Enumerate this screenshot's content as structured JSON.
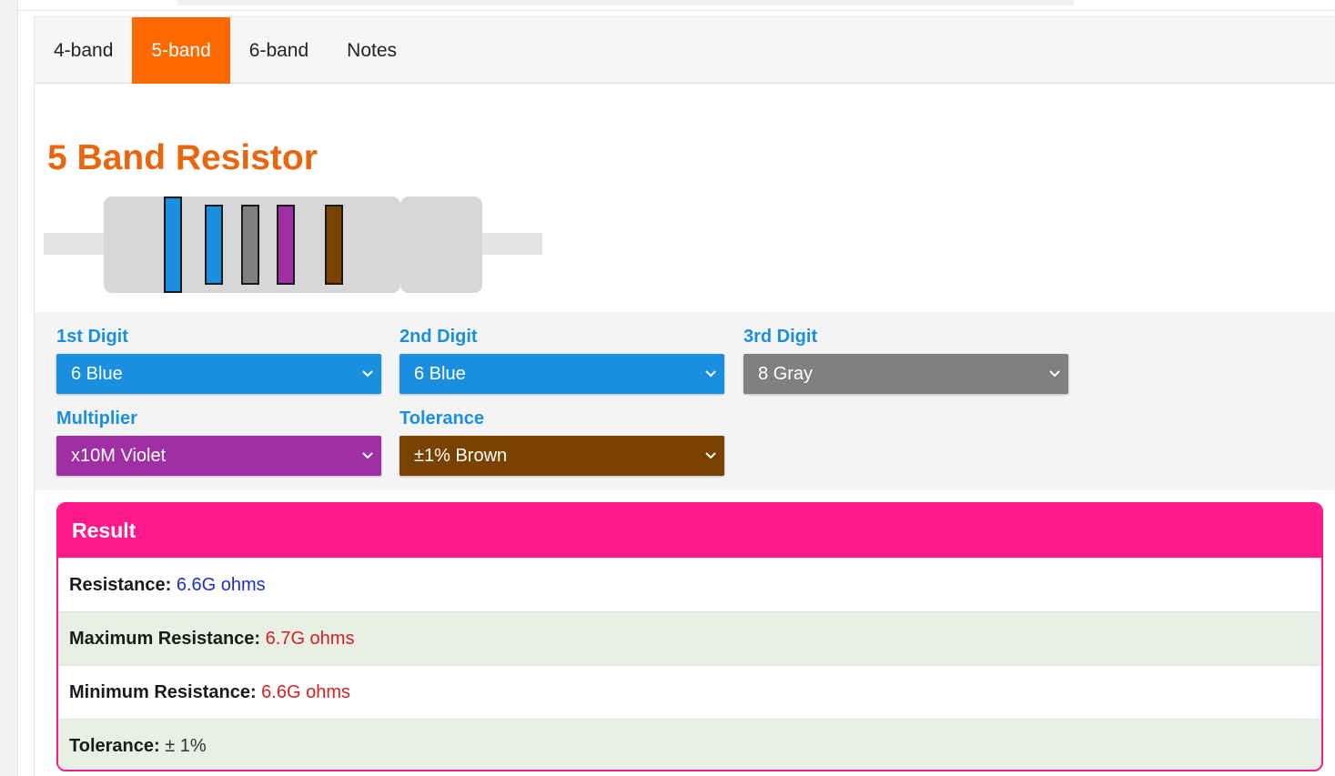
{
  "tabs": [
    {
      "label": "4-band",
      "active": false
    },
    {
      "label": "5-band",
      "active": true
    },
    {
      "label": "6-band",
      "active": false
    },
    {
      "label": "Notes",
      "active": false
    }
  ],
  "page": {
    "title": "5 Band Resistor"
  },
  "colors": {
    "accent_orange": "#ff6a00",
    "title_orange": "#e9650e",
    "label_blue": "#1a8fe0",
    "result_pink": "#ff1a8c",
    "band_blue": "#1a8fe0",
    "band_gray": "#808080",
    "band_violet": "#a02fa5",
    "band_brown": "#7a4200"
  },
  "resistor_bands": [
    {
      "name": "1st Digit",
      "color": "#1a8fe0"
    },
    {
      "name": "2nd Digit",
      "color": "#1a8fe0"
    },
    {
      "name": "3rd Digit",
      "color": "#808080"
    },
    {
      "name": "Multiplier",
      "color": "#a02fa5"
    },
    {
      "name": "Tolerance",
      "color": "#7a4200"
    }
  ],
  "selectors": {
    "digit1": {
      "label": "1st Digit",
      "value": "6 Blue",
      "color": "#1a8fe0"
    },
    "digit2": {
      "label": "2nd Digit",
      "value": "6 Blue",
      "color": "#1a8fe0"
    },
    "digit3": {
      "label": "3rd Digit",
      "value": "8 Gray",
      "color": "#808080"
    },
    "multiplier": {
      "label": "Multiplier",
      "value": "x10M Violet",
      "color": "#a02fa5"
    },
    "tolerance": {
      "label": "Tolerance",
      "value": "±1% Brown",
      "color": "#7a4200"
    }
  },
  "result": {
    "title": "Result",
    "rows": [
      {
        "key": "Resistance:",
        "value": "6.6G ohms"
      },
      {
        "key": "Maximum Resistance:",
        "value": "6.7G ohms"
      },
      {
        "key": "Minimum Resistance:",
        "value": "6.6G ohms"
      },
      {
        "key": "Tolerance:",
        "value": "± 1%"
      }
    ]
  }
}
